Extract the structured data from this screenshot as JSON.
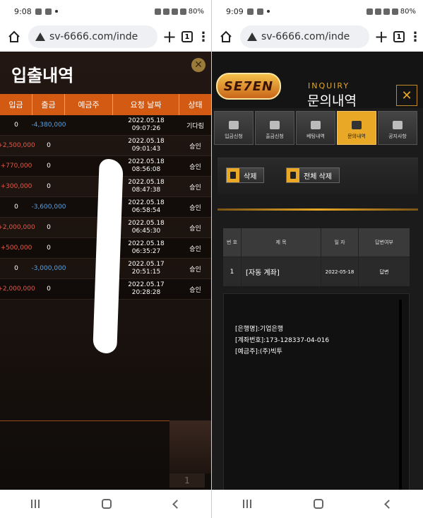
{
  "left": {
    "status": {
      "time": "9:08",
      "battery": "80%"
    },
    "browser": {
      "url": "sv-6666.com/inde",
      "tab_count": "1"
    },
    "panel": {
      "title": "입출내역",
      "headers": [
        "입금",
        "출금",
        "예금주",
        "요청 날짜",
        "상태"
      ],
      "rows": [
        {
          "deposit": "0",
          "withdraw": "-4,380,000",
          "date": "2022.05.18",
          "time": "09:07:26",
          "status": "기다림"
        },
        {
          "deposit": "+2,500,000",
          "withdraw": "0",
          "date": "2022.05.18",
          "time": "09:01:43",
          "status": "승인"
        },
        {
          "deposit": "+770,000",
          "withdraw": "0",
          "date": "2022.05.18",
          "time": "08:56:08",
          "status": "승인"
        },
        {
          "deposit": "+300,000",
          "withdraw": "0",
          "date": "2022.05.18",
          "time": "08:47:38",
          "status": "승인"
        },
        {
          "deposit": "0",
          "withdraw": "-3,600,000",
          "date": "2022.05.18",
          "time": "06:58:54",
          "status": "승인"
        },
        {
          "deposit": "+2,000,000",
          "withdraw": "0",
          "date": "2022.05.18",
          "time": "06:45:30",
          "status": "승인"
        },
        {
          "deposit": "+500,000",
          "withdraw": "0",
          "date": "2022.05.18",
          "time": "06:35:27",
          "status": "승인"
        },
        {
          "deposit": "0",
          "withdraw": "-3,000,000",
          "date": "2022.05.17",
          "time": "20:51:15",
          "status": "승인"
        },
        {
          "deposit": "+2,000,000",
          "withdraw": "0",
          "date": "2022.05.17",
          "time": "20:28:28",
          "status": "승인"
        }
      ],
      "page": "1"
    }
  },
  "right": {
    "status": {
      "time": "9:09",
      "battery": "80%"
    },
    "browser": {
      "url": "sv-6666.com/inde",
      "tab_count": "1"
    },
    "logo": "SE7EN",
    "header": {
      "subtitle": "INQUIRY",
      "title": "문의내역"
    },
    "tabs": [
      {
        "label": "입금신청",
        "active": false
      },
      {
        "label": "출금신청",
        "active": false
      },
      {
        "label": "베팅내역",
        "active": false
      },
      {
        "label": "문의내역",
        "active": true
      },
      {
        "label": "공지사항",
        "active": false
      }
    ],
    "buttons": {
      "delete": "삭제",
      "delete_all": "전체 삭제"
    },
    "table": {
      "headers": [
        "번 호",
        "제 목",
        "일 자",
        "답변여부"
      ],
      "rows": [
        {
          "no": "1",
          "title": "[자동 계좌]",
          "date": "2022-05-18",
          "answer": "답변"
        }
      ]
    },
    "answer_lines": [
      "[은행명]:기업은행",
      "[계좌번호]:173-128337-04-016",
      "[예금주]:(주)빅투"
    ]
  }
}
